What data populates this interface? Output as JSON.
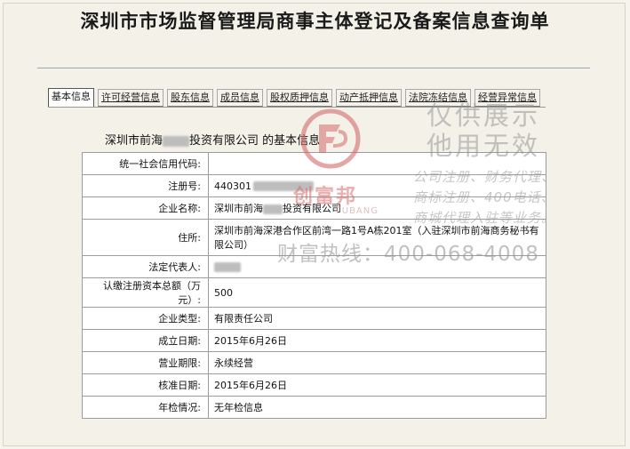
{
  "title": "深圳市市场监督管理局商事主体登记及备案信息查询单",
  "tabs": [
    "基本信息",
    "许可经营信息",
    "股东信息",
    "成员信息",
    "股权质押信息",
    "动产抵押信息",
    "法院冻结信息",
    "经营异常信息"
  ],
  "heading": {
    "prefix": "深圳市前海",
    "suffix": "投资有限公司",
    "tail": " 的基本信息"
  },
  "rows": [
    {
      "key": "统一社会信用代码:",
      "value": ""
    },
    {
      "key": "注册号:",
      "value": "440301"
    },
    {
      "key": "企业名称:",
      "value": "深圳市前海",
      "value_suffix": "投资有限公司"
    },
    {
      "key": "住所:",
      "value": "深圳市前海深港合作区前湾一路1号A栋201室（入驻深圳市前海商务秘书有限公司）"
    },
    {
      "key": "法定代表人:",
      "value": ""
    },
    {
      "key": "认缴注册资本总额（万元）:",
      "value": "500"
    },
    {
      "key": "企业类型:",
      "value": "有限责任公司"
    },
    {
      "key": "成立日期:",
      "value": "2015年6月26日"
    },
    {
      "key": "营业期限:",
      "value": "永续经营"
    },
    {
      "key": "核准日期:",
      "value": "2015年6月26日"
    },
    {
      "key": "年检情况:",
      "value": "无年检信息"
    }
  ],
  "watermark": {
    "line1": "仅供展示",
    "line2": "他用无效",
    "small1": "公司注册、财务代理、",
    "small2": "商标注册、400电话、",
    "small3": "商城代理入驻等业务。",
    "brand": "创富邦",
    "brand_en": "FUBANG",
    "hotline": "财富热线：400-068-4008"
  },
  "colors": {
    "accent_red": "#d46a6a",
    "border": "#9c9c9c"
  }
}
